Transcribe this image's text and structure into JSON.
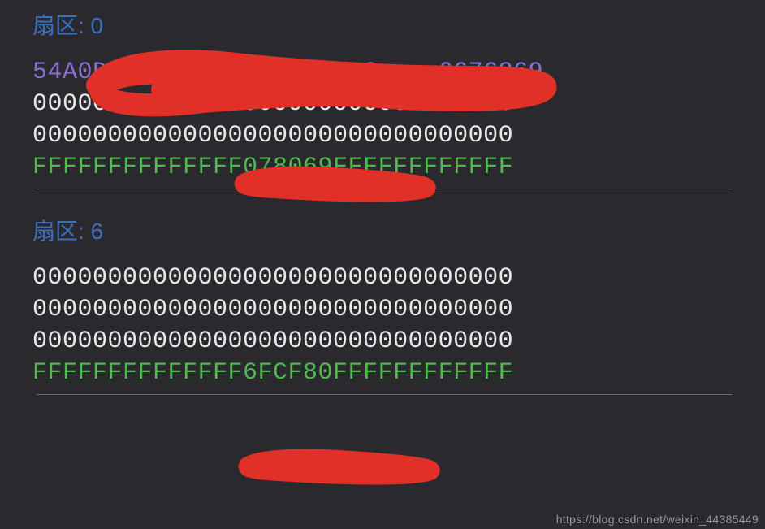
{
  "sectors": [
    {
      "label": "扇区: 0",
      "lines": [
        {
          "cls": "hex-purple",
          "text": "54A0DCAF0x2804006CAxxx0xxxx6676869"
        },
        {
          "cls": "hex-white",
          "text": "00000000000000000000000000000000"
        },
        {
          "cls": "hex-white",
          "text": "00000000000000000000000000000000"
        },
        {
          "cls": "hex-green",
          "text": "FFFFFFFFFFFFFF078069FFFFFFFFFFFF"
        }
      ]
    },
    {
      "label": "扇区: 6",
      "lines": [
        {
          "cls": "hex-white",
          "text": "00000000000000000000000000000000"
        },
        {
          "cls": "hex-white",
          "text": "00000000000000000000000000000000"
        },
        {
          "cls": "hex-white",
          "text": "00000000000000000000000000000000"
        },
        {
          "cls": "hex-green",
          "text": "FFFFFFFFFFFFFF6FCF80FFFFFFFFFFFF"
        }
      ]
    }
  ],
  "watermark": "https://blog.csdn.net/weixin_44385449"
}
